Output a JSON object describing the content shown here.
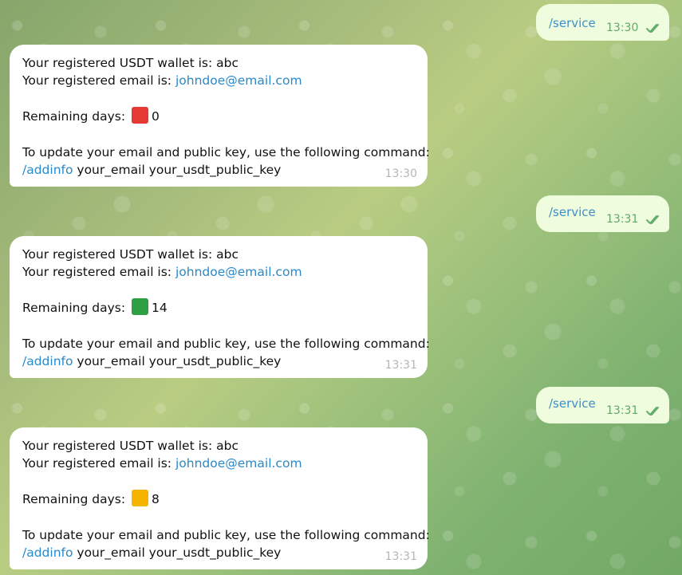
{
  "outgoing": [
    {
      "command": "/service",
      "time": "13:30",
      "status_icon": "double-check-icon"
    },
    {
      "command": "/service",
      "time": "13:31",
      "status_icon": "double-check-icon"
    },
    {
      "command": "/service",
      "time": "13:31",
      "status_icon": "double-check-icon"
    }
  ],
  "incoming": [
    {
      "wallet_line": "Your registered USDT wallet is: abc",
      "email_prefix": "Your registered email is: ",
      "email": "johndoe@email.com",
      "days_label": "Remaining days: ",
      "days_value": "0",
      "days_color": "#e53935",
      "update_text": "To update your email and public key, use the following command:",
      "update_command": "/addinfo",
      "update_args": " your_email your_usdt_public_key",
      "time": "13:30"
    },
    {
      "wallet_line": "Your registered USDT wallet is: abc",
      "email_prefix": "Your registered email is: ",
      "email": "johndoe@email.com",
      "days_label": "Remaining days: ",
      "days_value": "14",
      "days_color": "#2ea043",
      "update_text": "To update your email and public key, use the following command:",
      "update_command": "/addinfo",
      "update_args": " your_email your_usdt_public_key",
      "time": "13:31"
    },
    {
      "wallet_line": "Your registered USDT wallet is: abc",
      "email_prefix": "Your registered email is: ",
      "email": "johndoe@email.com",
      "days_label": "Remaining days: ",
      "days_value": "8",
      "days_color": "#f5b400",
      "update_text": "To update your email and public key, use the following command:",
      "update_command": "/addinfo",
      "update_args": " your_email your_usdt_public_key",
      "time": "13:31"
    }
  ]
}
